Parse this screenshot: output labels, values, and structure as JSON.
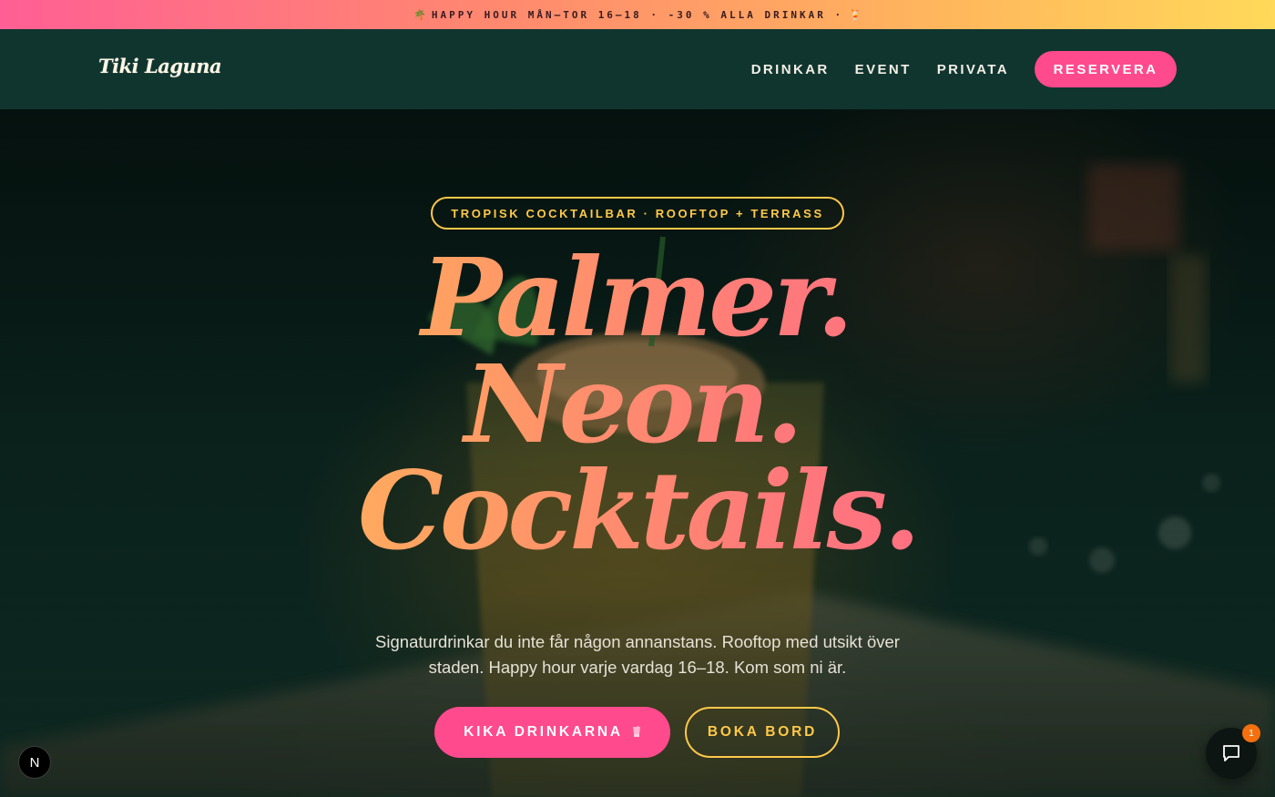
{
  "announcement": {
    "lead_icon": "🌴",
    "text": "HAPPY HOUR MÅN–TOR 16–18 · -30 % ALLA DRINKAR ·",
    "trail_icon": "🍹"
  },
  "header": {
    "logo": "Tiki Laguna",
    "nav": [
      "DRINKAR",
      "EVENT",
      "PRIVATA"
    ],
    "cta": "RESERVERA"
  },
  "hero": {
    "badge": "TROPISK COCKTAILBAR · ROOFTOP + TERRASS",
    "headline": [
      "Palmer.",
      "Neon.",
      "Cocktails."
    ],
    "lede": "Signaturdrinkar du inte får någon annanstans. Rooftop med utsikt över staden. Happy hour varje vardag 16–18. Kom som ni är.",
    "primary_button": "KIKA DRINKARNA",
    "primary_button_icon": "cocktail-icon",
    "secondary_button": "BOKA BORD"
  },
  "widgets": {
    "dev_badge": "N",
    "chat_icon": "chat-bubble-icon",
    "chat_count": "1"
  },
  "colors": {
    "accent_pink": "#ff4a8d",
    "accent_yellow": "#ffc94a",
    "header_bg": "#10352f",
    "announcement_gradient": [
      "#ff5f94",
      "#ffd95a"
    ],
    "headline_gradient": [
      "#ffcf5a",
      "#ff5a92"
    ]
  }
}
